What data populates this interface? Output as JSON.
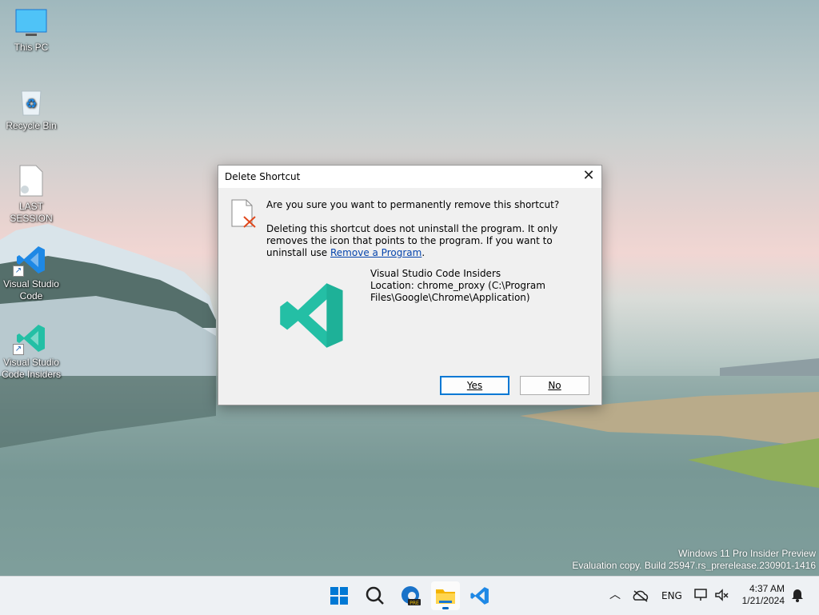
{
  "desktop": {
    "icons": [
      {
        "label": "This PC"
      },
      {
        "label": "Recycle Bin"
      },
      {
        "label": "LAST SESSION"
      },
      {
        "label": "Visual Studio Code"
      },
      {
        "label": "Visual Studio Code Insiders"
      }
    ],
    "watermark": {
      "line1": "Windows 11 Pro Insider Preview",
      "line2": "Evaluation copy. Build 25947.rs_prerelease.230901-1416"
    }
  },
  "dialog": {
    "title": "Delete Shortcut",
    "close_glyph": "✕",
    "question": "Are you sure you want to permanently remove this shortcut?",
    "desc_text": "Deleting this shortcut does not uninstall the program. It only removes the icon that points to the program. If you want to uninstall use ",
    "desc_link": "Remove a Program",
    "desc_end": ".",
    "item_name": "Visual Studio Code Insiders",
    "item_location": "Location: chrome_proxy (C:\\Program Files\\Google\\Chrome\\Application)",
    "yes_label": "Yes",
    "no_label": "No"
  },
  "taskbar": {
    "apps": [
      "start-icon",
      "search-icon",
      "edge-insider-icon",
      "file-explorer-icon",
      "vscode-icon"
    ],
    "tray": {
      "language": "ENG",
      "time": "4:37 AM",
      "date": "1/21/2024"
    }
  },
  "colors": {
    "vscode_blue": "#1e88e5",
    "vscode_insiders_teal": "#24bfa5",
    "accent": "#0078d4",
    "link": "#0645ad"
  }
}
